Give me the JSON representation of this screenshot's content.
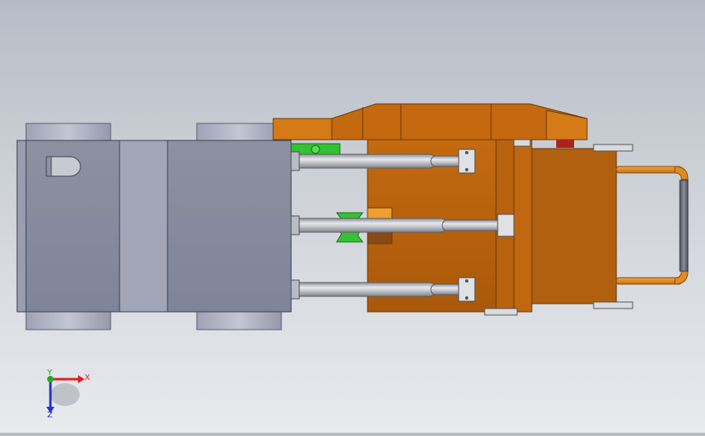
{
  "app": {
    "view": "cad-model-top-view"
  },
  "triad": {
    "x_label": "X",
    "y_label": "Y",
    "z_label": "Z",
    "x_color": "#e02020",
    "y_color": "#22aa22",
    "z_color": "#2233cc"
  },
  "colors": {
    "frame_gray": "#8e92a3",
    "frame_gray_light": "#a6a9b8",
    "orange_dark": "#b55d0c",
    "orange_mid": "#c86c10",
    "orange_light": "#d67d1c",
    "cylinder": "#c9cbd0",
    "bracket_green": "#2fbf2f",
    "pipe_orange": "#e28a20",
    "pipe_gray": "#6a6e78"
  }
}
